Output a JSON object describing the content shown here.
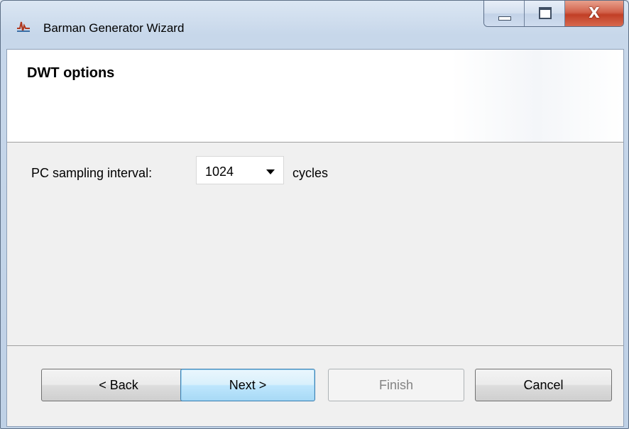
{
  "window": {
    "title": "Barman Generator Wizard",
    "icon": "barman-app-icon",
    "controls": {
      "minimize_icon": "minimize-icon",
      "maximize_icon": "maximize-icon",
      "close_glyph": "X"
    }
  },
  "page": {
    "title": "DWT options"
  },
  "form": {
    "sampling_label": "PC sampling interval:",
    "sampling_value": "1024",
    "sampling_unit": "cycles"
  },
  "buttons": {
    "back": "< Back",
    "next": "Next >",
    "finish": "Finish",
    "finish_enabled": false,
    "cancel": "Cancel"
  },
  "colors": {
    "close_button": "#c13f26",
    "default_button_border": "#3c7fb1",
    "disabled_text": "#838383"
  }
}
